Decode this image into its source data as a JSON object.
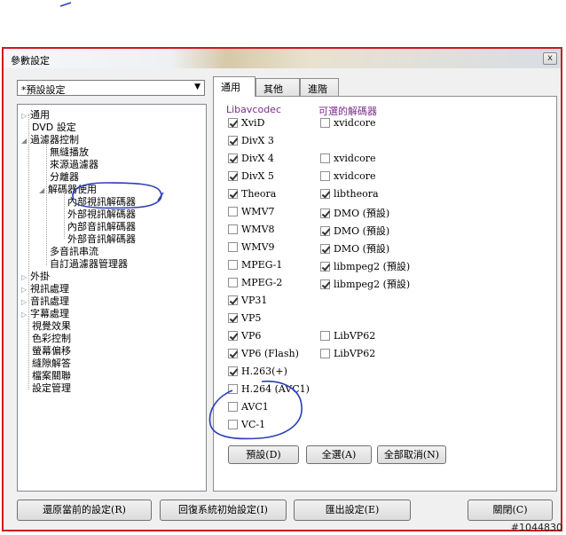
{
  "window": {
    "title": "參數設定",
    "close_glyph": "x"
  },
  "preset_select": {
    "value": "*預設設定",
    "arrow": "▼"
  },
  "tree": {
    "expander_glyph": "▷",
    "expanded_glyph": "◢",
    "items": [
      {
        "label": "通用"
      },
      {
        "label": "DVD 設定"
      },
      {
        "label": "過濾器控制"
      },
      {
        "label": "無縫播放"
      },
      {
        "label": "來源過濾器"
      },
      {
        "label": "分離器"
      },
      {
        "label": "解碼器使用"
      },
      {
        "label": "內部視訊解碼器"
      },
      {
        "label": "外部視訊解碼器"
      },
      {
        "label": "內部音訊解碼器"
      },
      {
        "label": "外部音訊解碼器"
      },
      {
        "label": "多音訊串流"
      },
      {
        "label": "自訂過濾器管理器"
      },
      {
        "label": "外掛"
      },
      {
        "label": "視訊處理"
      },
      {
        "label": "音訊處理"
      },
      {
        "label": "字幕處理"
      },
      {
        "label": "視覺效果"
      },
      {
        "label": "色彩控制"
      },
      {
        "label": "螢幕偏移"
      },
      {
        "label": "縫隙解答"
      },
      {
        "label": "檔案關聯"
      },
      {
        "label": "設定管理"
      }
    ]
  },
  "tabs": [
    {
      "label": "通用"
    },
    {
      "label": "其他"
    },
    {
      "label": "進階"
    }
  ],
  "panel": {
    "col1_header": "Libavcodec",
    "col2_header": "可選的解碼器",
    "left": [
      {
        "label": "XviD",
        "checked": true
      },
      {
        "label": "DivX 3",
        "checked": true
      },
      {
        "label": "DivX 4",
        "checked": true
      },
      {
        "label": "DivX 5",
        "checked": true
      },
      {
        "label": "Theora",
        "checked": true
      },
      {
        "label": "WMV7",
        "checked": false
      },
      {
        "label": "WMV8",
        "checked": false
      },
      {
        "label": "WMV9",
        "checked": false
      },
      {
        "label": "MPEG-1",
        "checked": false
      },
      {
        "label": "MPEG-2",
        "checked": false
      },
      {
        "label": "VP31",
        "checked": true
      },
      {
        "label": "VP5",
        "checked": true
      },
      {
        "label": "VP6",
        "checked": true
      },
      {
        "label": "VP6 (Flash)",
        "checked": true
      },
      {
        "label": "H.263(+)",
        "checked": true
      },
      {
        "label": "H.264 (AVC1)",
        "checked": false
      },
      {
        "label": "AVC1",
        "checked": false
      },
      {
        "label": "VC-1",
        "checked": false
      }
    ],
    "right": [
      {
        "label": "xvidcore",
        "checked": false
      },
      null,
      {
        "label": "xvidcore",
        "checked": false
      },
      {
        "label": "xvidcore",
        "checked": false
      },
      {
        "label": "libtheora",
        "checked": true
      },
      {
        "label": "DMO (預設)",
        "checked": true
      },
      {
        "label": "DMO (預設)",
        "checked": true
      },
      {
        "label": "DMO (預設)",
        "checked": true
      },
      {
        "label": "libmpeg2 (預設)",
        "checked": true
      },
      {
        "label": "libmpeg2 (預設)",
        "checked": true
      },
      null,
      null,
      {
        "label": "LibVP62",
        "checked": false
      },
      {
        "label": "LibVP62",
        "checked": false
      }
    ],
    "buttons": {
      "default": "預設(D)",
      "select_all": "全選(A)",
      "deselect_all": "全部取消(N)"
    }
  },
  "footer": {
    "restore": "還原當前的設定(R)",
    "reset": "回復系統初始設定(I)",
    "export": "匯出設定(E)",
    "close": "關閉(C)"
  },
  "watermark": "#1044830",
  "annotation_color": "#2b3fb8"
}
